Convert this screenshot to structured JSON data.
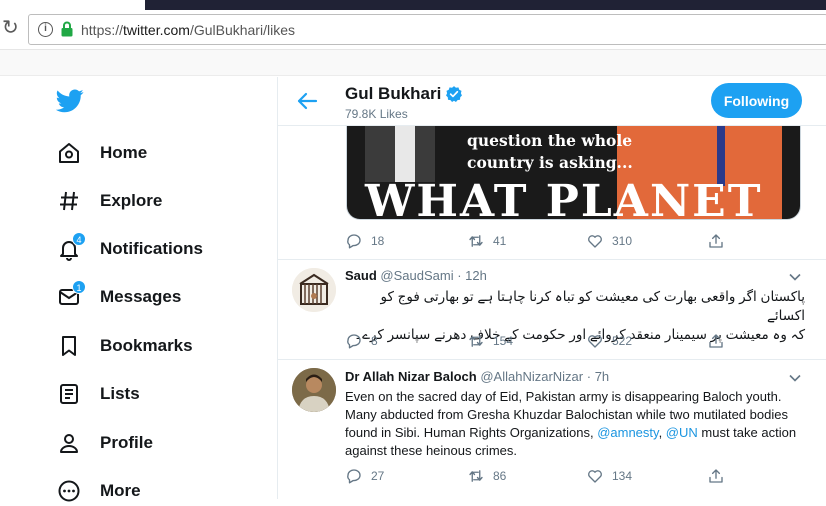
{
  "browser": {
    "url_scheme": "https://",
    "url_host": "twitter.com",
    "url_path": "/GulBukhari/likes"
  },
  "sidebar": {
    "items": [
      {
        "label": "Home",
        "icon": "home-icon"
      },
      {
        "label": "Explore",
        "icon": "hashtag-icon"
      },
      {
        "label": "Notifications",
        "icon": "bell-icon",
        "badge": "4"
      },
      {
        "label": "Messages",
        "icon": "mail-icon",
        "badge": "1"
      },
      {
        "label": "Bookmarks",
        "icon": "bookmark-icon"
      },
      {
        "label": "Lists",
        "icon": "list-icon"
      },
      {
        "label": "Profile",
        "icon": "person-icon"
      },
      {
        "label": "More",
        "icon": "more-circle-icon"
      }
    ]
  },
  "header": {
    "name": "Gul Bukhari",
    "subtitle": "79.8K Likes",
    "follow_label": "Following"
  },
  "media": {
    "caption_line1": "question the whole",
    "caption_line2": "country is asking...",
    "big_text": "WHAT PLANET"
  },
  "tweets": [
    {
      "replies": "18",
      "retweets": "41",
      "likes": "310"
    },
    {
      "name": "Saud",
      "handle": "@SaudSami",
      "time": "· 12h",
      "text_line1": "پاکستان اگر واقعی بھارت کی معیشت کو تباہ کرنا چاہتا ہے تو بھارتی فوج کو اکسائے",
      "text_line2": "کہ وہ معیشت پر سیمینار منعقد کروائے اور حکومت کے خلاف دھرنے سپانسر کرے۔",
      "replies": "8",
      "retweets": "154",
      "likes": "522"
    },
    {
      "name": "Dr Allah Nizar Baloch",
      "handle": "@AllahNizarNizar",
      "time": "· 7h",
      "text_part1": "Even on the sacred day of Eid, Pakistan army is disappearing Baloch youth. Many abducted from Gresha Khuzdar Balochistan while two mutilated bodies found in Sibi. Human Rights Organizations, ",
      "mention1": "@amnesty",
      "sep": ", ",
      "mention2": "@UN",
      "text_part2": " must take action against these heinous crimes.",
      "replies": "27",
      "retweets": "86",
      "likes": "134"
    }
  ],
  "colors": {
    "accent": "#1da1f2",
    "secondary_text": "#657786",
    "border": "#e6ecf0"
  }
}
